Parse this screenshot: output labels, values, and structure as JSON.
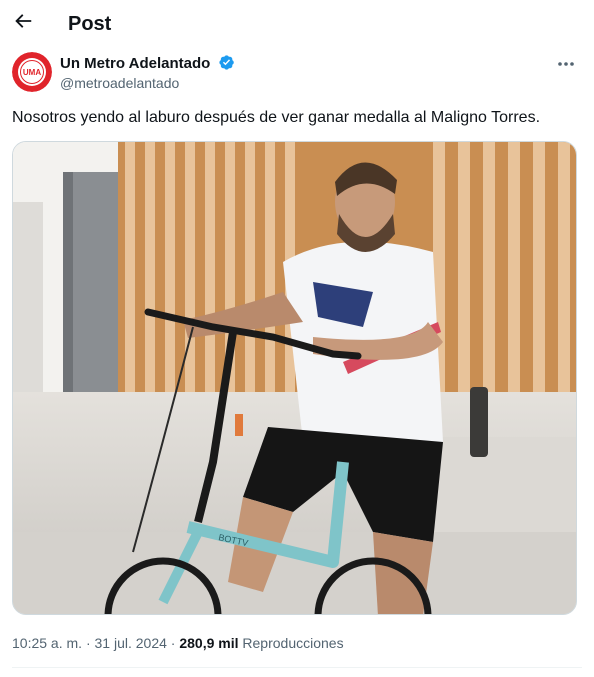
{
  "header": {
    "title": "Post"
  },
  "author": {
    "name": "Un Metro Adelantado",
    "handle": "@metroadelantado",
    "avatar_text": "UMA",
    "avatar_ring_text": "UN METRO ADELANTADO"
  },
  "post": {
    "text": "Nosotros yendo al laburo después de ver ganar medalla al Maligno Torres.",
    "media_description": "Photo of a bearded man in a white t-shirt and black shorts riding a teal folding bicycle in front of wooden slats",
    "bike_brand": "BOTTV"
  },
  "meta": {
    "time": "10:25 a. m.",
    "sep1": "·",
    "date": "31 jul. 2024",
    "sep2": "·",
    "views_count": "280,9 mil",
    "views_label": "Reproducciones"
  },
  "colors": {
    "accent_verified": "#1d9bf0",
    "brand_red": "#e0242b",
    "text_secondary": "#536471",
    "bike_teal": "#7fc4c9"
  },
  "icons": {
    "back": "arrow-left-icon",
    "verified": "verified-badge-icon",
    "more": "more-horizontal-icon"
  }
}
